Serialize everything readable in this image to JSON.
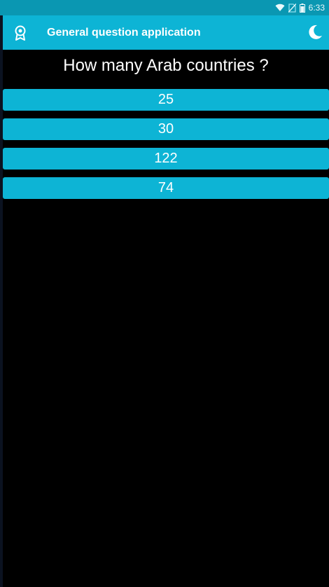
{
  "status_bar": {
    "time": "6:33",
    "icons": [
      "wifi-icon",
      "no-sim-icon",
      "battery-icon"
    ]
  },
  "app_bar": {
    "title": "General question application",
    "left_icon": "award-icon",
    "right_icon": "moon-icon"
  },
  "quiz": {
    "question": "How many Arab countries ?",
    "answers": [
      "25",
      "30",
      "122",
      "74"
    ]
  },
  "colors": {
    "primary": "#0db4d5",
    "status_bar": "#0a97b2",
    "background": "#000000",
    "text": "#ffffff"
  }
}
